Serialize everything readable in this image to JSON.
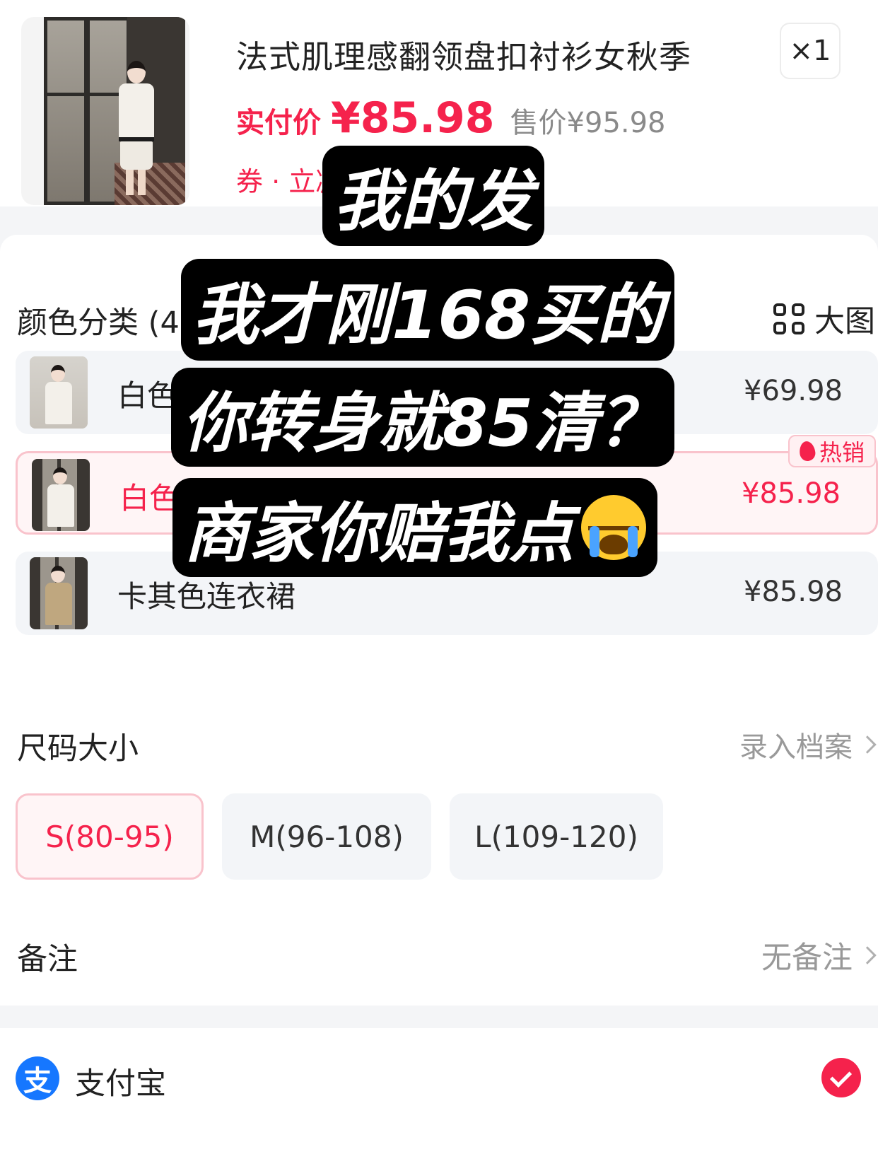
{
  "product": {
    "title": "法式肌理感翻领盘扣衬衫女秋季",
    "quantity": "×1",
    "pay_label": "实付价",
    "pay_price": "¥85.98",
    "original_price": "售价¥95.98",
    "coupon": "券 · 立减"
  },
  "color_section": {
    "heading": "颜色分类 (4)",
    "view_toggle": "大图",
    "options": [
      {
        "label": "白色衬衫",
        "price": "¥69.98"
      },
      {
        "label": "白色连衣裙",
        "price": "¥85.98",
        "badge": "热销"
      },
      {
        "label": "卡其色连衣裙",
        "price": "¥85.98"
      }
    ]
  },
  "size_section": {
    "heading": "尺码大小",
    "link": "录入档案",
    "options": [
      "S(80-95)",
      "M(96-108)",
      "L(109-120)"
    ],
    "selected": "S(80-95)"
  },
  "remark": {
    "heading": "备注",
    "value": "无备注"
  },
  "payment": {
    "method": "支付宝",
    "icon_char": "支",
    "accent": "#f5224c",
    "alipay_color": "#1677ff"
  },
  "caption": {
    "line1": "我的发",
    "line2": "我才刚168买的",
    "line3": "你转身就85清？",
    "line4": "商家你赔我点"
  }
}
